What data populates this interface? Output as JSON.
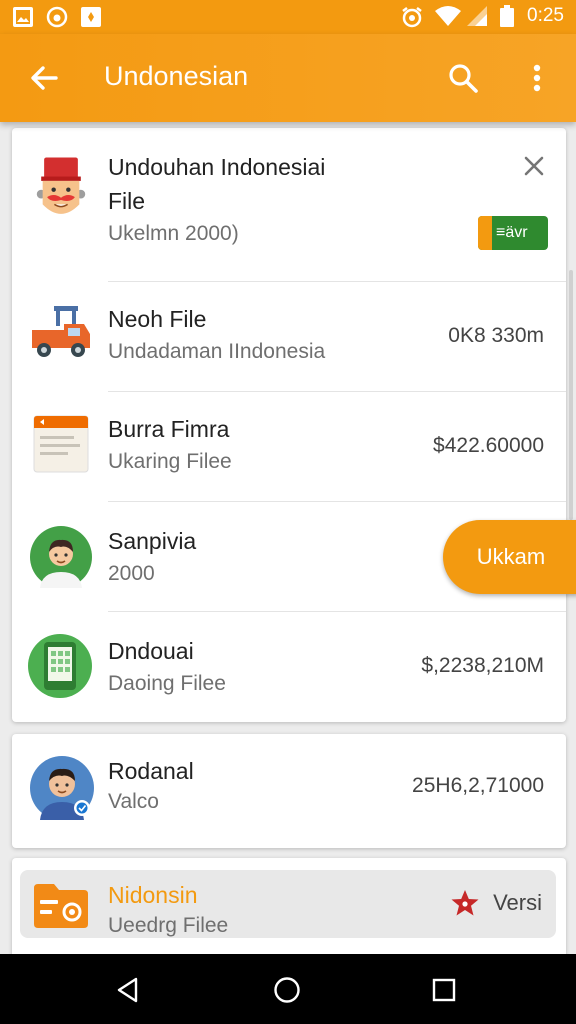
{
  "status_bar": {
    "time": "0:25",
    "left_icons": [
      "image-icon",
      "app-icon",
      "notification-icon"
    ],
    "right_icons": [
      "alarm-icon",
      "wifi-icon",
      "signal-icon",
      "battery-icon"
    ]
  },
  "app_bar": {
    "title": "Undonesian",
    "icons": [
      "back-arrow-icon",
      "search-icon",
      "more-vert-icon"
    ]
  },
  "items": [
    {
      "title_line1": "Undouhan Indonesiai",
      "title_line2": "File",
      "subtitle": "Ukelmn 2000)",
      "badge": "≡ävr",
      "icon": "man-fez-avatar-icon"
    },
    {
      "title": "Neoh File",
      "subtitle": "Undadaman IIndonesia",
      "value": "0K8 330m",
      "icon": "truck-icon"
    },
    {
      "title": "Burra Fimra",
      "subtitle": "Ukaring Filee",
      "value": "$422.60000",
      "icon": "document-icon"
    },
    {
      "title": "Sanpivia",
      "subtitle": "2000",
      "button": "Ukkam",
      "icon": "boy-avatar-icon"
    },
    {
      "title": "Dndouai",
      "subtitle": "Daoing Filee",
      "value": "$,2238,210M",
      "icon": "calculator-icon"
    },
    {
      "title": "Rodanal",
      "subtitle": "Valco",
      "value": "25H6,2,71000",
      "icon": "man-avatar-icon"
    },
    {
      "title": "Nidonsin",
      "subtitle": "Ueedrg Filee",
      "value": "Versi",
      "icon": "folder-icon"
    }
  ],
  "colors": {
    "accent": "#f39a10",
    "badge_green": "#2f8a2f",
    "star_red": "#c62828"
  },
  "nav_bar": [
    "back-triangle-icon",
    "home-circle-icon",
    "recents-square-icon"
  ]
}
